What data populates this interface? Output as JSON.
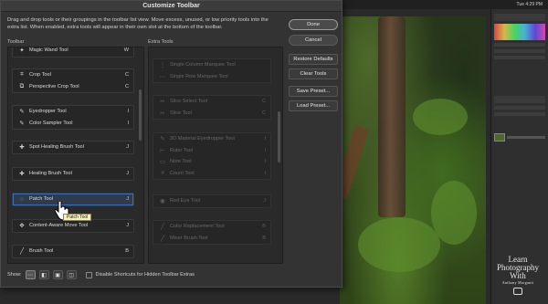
{
  "dialog": {
    "title": "Customize Toolbar",
    "description": "Drag and drop tools or their groupings in the toolbar list view. Move excess, unused, or low priority tools into the extra list. When enabled, extra tools will appear in their own slot at the bottom of the toolbar.",
    "toolbar_label": "Toolbar",
    "extra_label": "Extra Tools"
  },
  "toolbar_groups": [
    {
      "rows": [
        {
          "icon": "magic-wand-icon",
          "glyph": "✦",
          "label": "Magic Wand Tool",
          "key": "W"
        }
      ]
    },
    {
      "rows": [
        {
          "icon": "crop-icon",
          "glyph": "⌗",
          "label": "Crop Tool",
          "key": "C"
        },
        {
          "icon": "perspective-crop-icon",
          "glyph": "⧉",
          "label": "Perspective Crop Tool",
          "key": "C"
        }
      ]
    },
    {
      "rows": [
        {
          "icon": "eyedropper-icon",
          "glyph": "✎",
          "label": "Eyedropper Tool",
          "key": "I"
        },
        {
          "icon": "color-sampler-icon",
          "glyph": "✎",
          "label": "Color Sampler Tool",
          "key": "I"
        }
      ]
    },
    {
      "rows": [
        {
          "icon": "spot-healing-brush-icon",
          "glyph": "✚",
          "label": "Spot Healing Brush Tool",
          "key": "J"
        }
      ]
    },
    {
      "rows": [
        {
          "icon": "healing-brush-icon",
          "glyph": "✚",
          "label": "Healing Brush Tool",
          "key": "J"
        }
      ]
    },
    {
      "rows": [
        {
          "icon": "patch-icon",
          "glyph": "◌",
          "label": "Patch Tool",
          "key": "J"
        }
      ]
    },
    {
      "rows": [
        {
          "icon": "content-aware-move-icon",
          "glyph": "✥",
          "label": "Content-Aware Move Tool",
          "key": "J"
        }
      ]
    },
    {
      "rows": [
        {
          "icon": "brush-icon",
          "glyph": "╱",
          "label": "Brush Tool",
          "key": "B"
        }
      ]
    }
  ],
  "extra_groups": [
    {
      "rows": [
        {
          "icon": "single-column-marquee-icon",
          "glyph": "⋮",
          "label": "Single Column Marquee Tool",
          "key": ""
        },
        {
          "icon": "single-row-marquee-icon",
          "glyph": "⋯",
          "label": "Single Row Marquee Tool",
          "key": ""
        }
      ]
    },
    {
      "rows": [
        {
          "icon": "slice-select-icon",
          "glyph": "✂",
          "label": "Slice Select Tool",
          "key": "C"
        },
        {
          "icon": "slice-icon",
          "glyph": "✂",
          "label": "Slice Tool",
          "key": "C"
        }
      ]
    },
    {
      "rows": [
        {
          "icon": "3d-material-eyedropper-icon",
          "glyph": "✎",
          "label": "3D Material Eyedropper Tool",
          "key": "I"
        },
        {
          "icon": "ruler-icon",
          "glyph": "⊢",
          "label": "Ruler Tool",
          "key": "I"
        },
        {
          "icon": "note-icon",
          "glyph": "▭",
          "label": "Note Tool",
          "key": "I"
        },
        {
          "icon": "count-icon",
          "glyph": "#",
          "label": "Count Tool",
          "key": "I"
        }
      ]
    },
    {
      "rows": [
        {
          "icon": "red-eye-icon",
          "glyph": "◉",
          "label": "Red Eye Tool",
          "key": "J"
        }
      ]
    },
    {
      "rows": [
        {
          "icon": "color-replacement-icon",
          "glyph": "╱",
          "label": "Color Replacement Tool",
          "key": "B"
        },
        {
          "icon": "mixer-brush-icon",
          "glyph": "╱",
          "label": "Mixer Brush Tool",
          "key": "B"
        }
      ]
    }
  ],
  "buttons": {
    "done": "Done",
    "cancel": "Cancel",
    "restore_defaults": "Restore Defaults",
    "clear_tools": "Clear Tools",
    "save_preset": "Save Preset...",
    "load_preset": "Load Preset..."
  },
  "bottom": {
    "show_label": "Show:",
    "show_icons": [
      "more-icon",
      "brush-settings-icon",
      "screen-mode-icon",
      "quick-mask-icon"
    ],
    "disable_shortcuts_label": "Disable Shortcuts for Hidden Toolbar Extras"
  },
  "tooltip": "Patch Tool",
  "watermark": {
    "line1": "Learn",
    "line2": "Photography",
    "line3": "With",
    "line4": "Anthony Morganti"
  },
  "menubar_text": "Tue 4:29 PM"
}
